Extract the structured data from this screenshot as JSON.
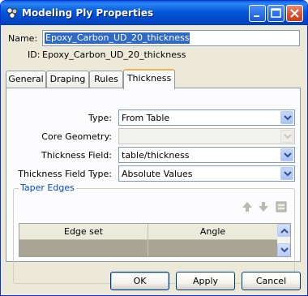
{
  "window": {
    "title": "Modeling Ply Properties"
  },
  "header": {
    "name_label": "Name:",
    "name_value": "Epoxy_Carbon_UD_20_thickness",
    "id_label": "ID:",
    "id_value": "Epoxy_Carbon_UD_20_thickness"
  },
  "tabs": [
    {
      "label": "General"
    },
    {
      "label": "Draping"
    },
    {
      "label": "Rules"
    },
    {
      "label": "Thickness",
      "active": true
    }
  ],
  "form": {
    "type_label": "Type:",
    "type_value": "From Table",
    "core_geometry_label": "Core Geometry:",
    "core_geometry_value": "",
    "thickness_field_label": "Thickness Field:",
    "thickness_field_value": "table/thickness",
    "thickness_field_type_label": "Thickness Field Type:",
    "thickness_field_type_value": "Absolute Values"
  },
  "taper_edges": {
    "title": "Taper Edges",
    "columns": [
      "Edge set",
      "Angle"
    ]
  },
  "footer": {
    "ok_label": "OK",
    "apply_label": "Apply",
    "cancel_label": "Cancel"
  },
  "colors": {
    "titlebar": "#0458d8",
    "selection": "#316ac5",
    "selected_row": "#a9a594",
    "group_title": "#0046d5"
  }
}
